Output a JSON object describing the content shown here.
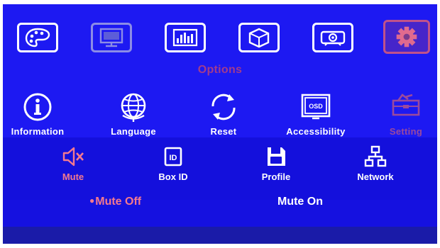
{
  "menu_title": "Options",
  "top_tabs": [
    {
      "icon": "palette-icon",
      "state": "normal"
    },
    {
      "icon": "monitor-icon",
      "state": "dim"
    },
    {
      "icon": "equalizer-icon",
      "state": "normal"
    },
    {
      "icon": "3d-cube-icon",
      "state": "normal"
    },
    {
      "icon": "projector-icon",
      "state": "normal"
    },
    {
      "icon": "gear-icon",
      "state": "selected"
    }
  ],
  "options_row": [
    {
      "label": "Information",
      "icon": "info-icon"
    },
    {
      "label": "Language",
      "icon": "globe-icon"
    },
    {
      "label": "Reset",
      "icon": "reset-icon"
    },
    {
      "label": "Accessibility",
      "icon": "osd-icon"
    },
    {
      "label": "Setting",
      "icon": "toolbox-icon",
      "state": "selected"
    }
  ],
  "setting_row": [
    {
      "label": "Mute",
      "icon": "speaker-mute-icon",
      "state": "selected"
    },
    {
      "label": "Box ID",
      "icon": "id-card-icon"
    },
    {
      "label": "Profile",
      "icon": "save-icon"
    },
    {
      "label": "Network",
      "icon": "network-icon"
    }
  ],
  "mute_options": {
    "off": "Mute Off",
    "on": "Mute On",
    "selected": "off",
    "bullet": "●"
  },
  "colors": {
    "background": "#1a16ee",
    "selected_text": "#f47a8e",
    "section_title": "#a23c8c",
    "text": "#ffffff"
  }
}
